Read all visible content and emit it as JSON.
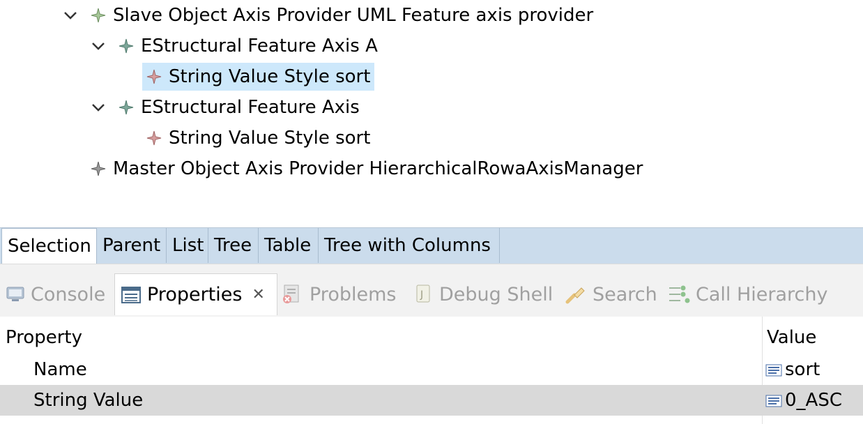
{
  "tree": {
    "nodes": [
      {
        "label": "Slave Object Axis Provider UML Feature axis provider",
        "expanded": true,
        "icon": "diamond-green-icon"
      },
      {
        "label": "EStructural Feature Axis A",
        "expanded": true,
        "icon": "diamond-teal-icon"
      },
      {
        "label": "String Value Style sort",
        "selected": true,
        "icon": "diamond-red-icon"
      },
      {
        "label": "EStructural Feature Axis",
        "expanded": true,
        "icon": "diamond-teal-icon"
      },
      {
        "label": "String Value Style sort",
        "icon": "diamond-red-icon"
      },
      {
        "label": "Master Object Axis Provider HierarchicalRowaAxisManager",
        "icon": "diamond-gray-icon"
      }
    ]
  },
  "view_tabs": [
    "Selection",
    "Parent",
    "List",
    "Tree",
    "Table",
    "Tree with Columns"
  ],
  "stack_tabs": [
    {
      "label": "Console",
      "icon": "console-icon"
    },
    {
      "label": "Properties",
      "icon": "properties-icon",
      "active": true
    },
    {
      "label": "Problems",
      "icon": "problems-icon"
    },
    {
      "label": "Debug Shell",
      "icon": "debug-shell-icon"
    },
    {
      "label": "Search",
      "icon": "search-icon"
    },
    {
      "label": "Call Hierarchy",
      "icon": "call-hierarchy-icon"
    }
  ],
  "properties": {
    "headers": {
      "property": "Property",
      "value": "Value"
    },
    "rows": [
      {
        "property": "Name",
        "value": "sort"
      },
      {
        "property": "String Value",
        "value": "0_ASC",
        "selected": true
      }
    ]
  },
  "colors": {
    "selection": "#cde8fb",
    "tabbar": "#cbdcec",
    "row_selected": "#d9d9d9"
  }
}
